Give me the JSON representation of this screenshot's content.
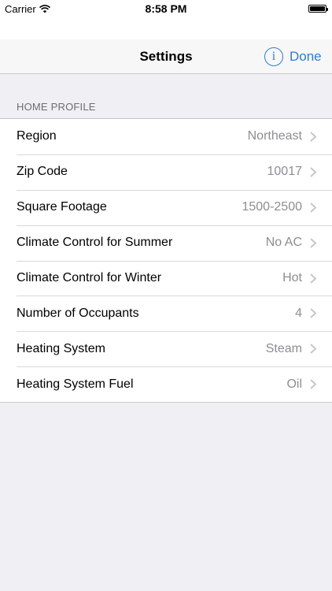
{
  "status_bar": {
    "carrier": "Carrier",
    "time": "8:58 PM"
  },
  "nav": {
    "title": "Settings",
    "info_icon": "i",
    "done_label": "Done",
    "accent_color": "#2a7fd8"
  },
  "section": {
    "header": "HOME PROFILE"
  },
  "rows": [
    {
      "label": "Region",
      "value": "Northeast"
    },
    {
      "label": "Zip Code",
      "value": "10017"
    },
    {
      "label": "Square Footage",
      "value": "1500-2500"
    },
    {
      "label": "Climate Control for Summer",
      "value": "No AC"
    },
    {
      "label": "Climate Control for Winter",
      "value": "Hot"
    },
    {
      "label": "Number of Occupants",
      "value": "4"
    },
    {
      "label": "Heating System",
      "value": "Steam"
    },
    {
      "label": "Heating System Fuel",
      "value": "Oil"
    }
  ]
}
